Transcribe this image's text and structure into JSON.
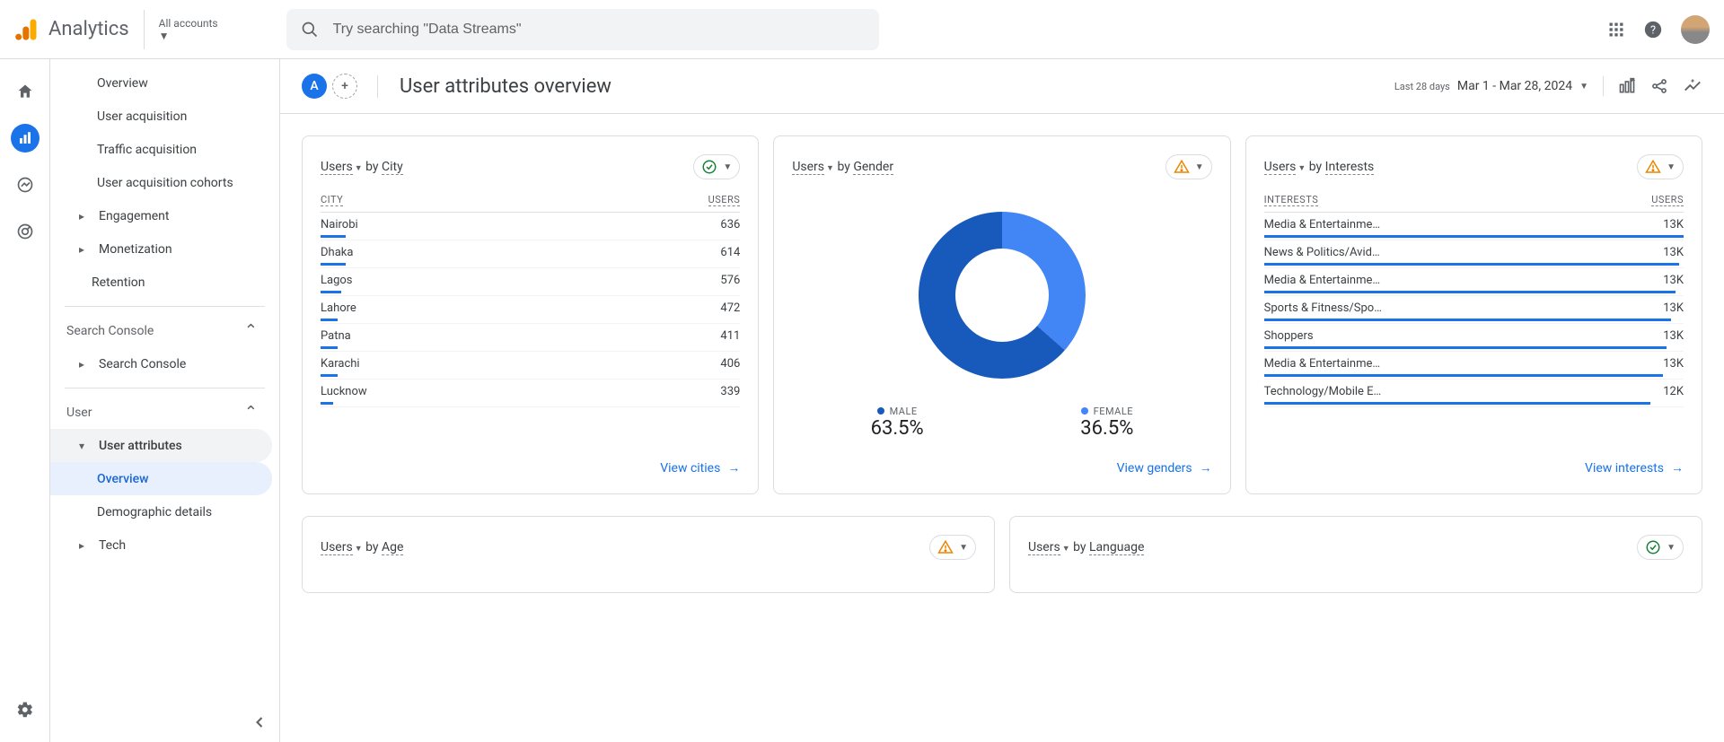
{
  "brand": "Analytics",
  "account": {
    "label": "All accounts"
  },
  "search": {
    "placeholder": "Try searching \"Data Streams\""
  },
  "sidebar": {
    "items": [
      {
        "label": "Overview",
        "level": "sub"
      },
      {
        "label": "User acquisition",
        "level": "sub"
      },
      {
        "label": "Traffic acquisition",
        "level": "sub"
      },
      {
        "label": "User acquisition cohorts",
        "level": "sub"
      },
      {
        "label": "Engagement",
        "level": "top",
        "caret": true
      },
      {
        "label": "Monetization",
        "level": "top",
        "caret": true
      },
      {
        "label": "Retention",
        "level": "top"
      },
      {
        "label": "Search Console",
        "level": "section",
        "expand": true
      },
      {
        "label": "Search Console",
        "level": "top",
        "caret": true
      },
      {
        "label": "User",
        "level": "section",
        "expand": true
      },
      {
        "label": "User attributes",
        "level": "top",
        "caret": true,
        "highlighted": true
      },
      {
        "label": "Overview",
        "level": "subsub",
        "selected": true
      },
      {
        "label": "Demographic details",
        "level": "subsub"
      },
      {
        "label": "Tech",
        "level": "top",
        "caret": true
      }
    ]
  },
  "header": {
    "segment_letter": "A",
    "title": "User attributes overview",
    "date_sub": "Last 28 days",
    "date_range": "Mar 1 - Mar 28, 2024"
  },
  "cards": {
    "city": {
      "metric": "Users",
      "by": "by",
      "dim": "City",
      "col1": "CITY",
      "col2": "USERS",
      "rows": [
        {
          "k": "Nairobi",
          "v": "636",
          "bar": 6
        },
        {
          "k": "Dhaka",
          "v": "614",
          "bar": 6
        },
        {
          "k": "Lagos",
          "v": "576",
          "bar": 5
        },
        {
          "k": "Lahore",
          "v": "472",
          "bar": 4
        },
        {
          "k": "Patna",
          "v": "411",
          "bar": 4
        },
        {
          "k": "Karachi",
          "v": "406",
          "bar": 4
        },
        {
          "k": "Lucknow",
          "v": "339",
          "bar": 3
        }
      ],
      "link": "View cities"
    },
    "gender": {
      "metric": "Users",
      "by": "by",
      "dim": "Gender",
      "male_label": "MALE",
      "female_label": "FEMALE",
      "male_pct": "63.5%",
      "female_pct": "36.5%",
      "link": "View genders"
    },
    "interests": {
      "metric": "Users",
      "by": "by",
      "dim": "Interests",
      "col1": "INTERESTS",
      "col2": "USERS",
      "rows": [
        {
          "k": "Media & Entertainme…",
          "v": "13K",
          "bar": 100
        },
        {
          "k": "News & Politics/Avid…",
          "v": "13K",
          "bar": 99
        },
        {
          "k": "Media & Entertainme…",
          "v": "13K",
          "bar": 98
        },
        {
          "k": "Sports & Fitness/Spo…",
          "v": "13K",
          "bar": 97
        },
        {
          "k": "Shoppers",
          "v": "13K",
          "bar": 96
        },
        {
          "k": "Media & Entertainme…",
          "v": "13K",
          "bar": 95
        },
        {
          "k": "Technology/Mobile E…",
          "v": "12K",
          "bar": 92
        }
      ],
      "link": "View interests"
    },
    "age": {
      "metric": "Users",
      "by": "by",
      "dim": "Age"
    },
    "language": {
      "metric": "Users",
      "by": "by",
      "dim": "Language"
    }
  },
  "chart_data": {
    "type": "pie",
    "title": "Users by Gender",
    "series": [
      {
        "name": "MALE",
        "value": 63.5,
        "color": "#185abc"
      },
      {
        "name": "FEMALE",
        "value": 36.5,
        "color": "#4285f4"
      }
    ]
  }
}
